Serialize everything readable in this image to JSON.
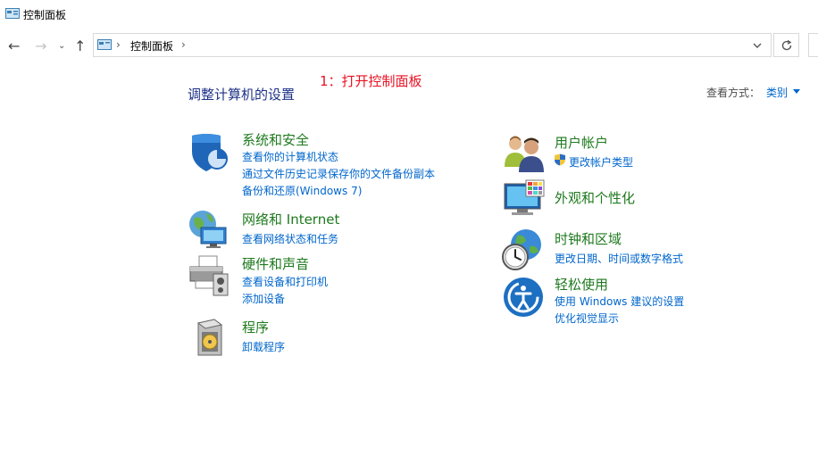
{
  "window": {
    "title": "控制面板"
  },
  "address": {
    "crumb": "控制面板"
  },
  "header": {
    "title": "调整计算机的设置",
    "annotation": "1：打开控制面板"
  },
  "view": {
    "label": "查看方式：",
    "value": "类别"
  },
  "categories": {
    "system": {
      "title": "系统和安全",
      "links": [
        "查看你的计算机状态",
        "通过文件历史记录保存你的文件备份副本",
        "备份和还原(Windows 7)"
      ]
    },
    "network": {
      "title": "网络和 Internet",
      "links": [
        "查看网络状态和任务"
      ]
    },
    "hardware": {
      "title": "硬件和声音",
      "links": [
        "查看设备和打印机",
        "添加设备"
      ]
    },
    "programs": {
      "title": "程序",
      "links": [
        "卸载程序"
      ]
    },
    "users": {
      "title": "用户帐户",
      "links": [
        "更改帐户类型"
      ]
    },
    "appearance": {
      "title": "外观和个性化",
      "links": []
    },
    "clock": {
      "title": "时钟和区域",
      "links": [
        "更改日期、时间或数字格式"
      ]
    },
    "ease": {
      "title": "轻松使用",
      "links": [
        "使用 Windows 建议的设置",
        "优化视觉显示"
      ]
    }
  },
  "colors": {
    "link": "#0066cc",
    "category": "#1e7a1e",
    "header": "#1e3287",
    "annotation": "#e81123"
  },
  "icons": [
    "back-icon",
    "forward-icon",
    "recent-dropdown-icon",
    "up-icon",
    "control-panel-icon",
    "chevron-down-icon",
    "refresh-icon",
    "shield-icon",
    "network-icon",
    "printer-icon",
    "programs-icon",
    "users-icon",
    "monitor-icon",
    "clock-globe-icon",
    "ease-of-access-icon",
    "uac-shield-icon"
  ]
}
